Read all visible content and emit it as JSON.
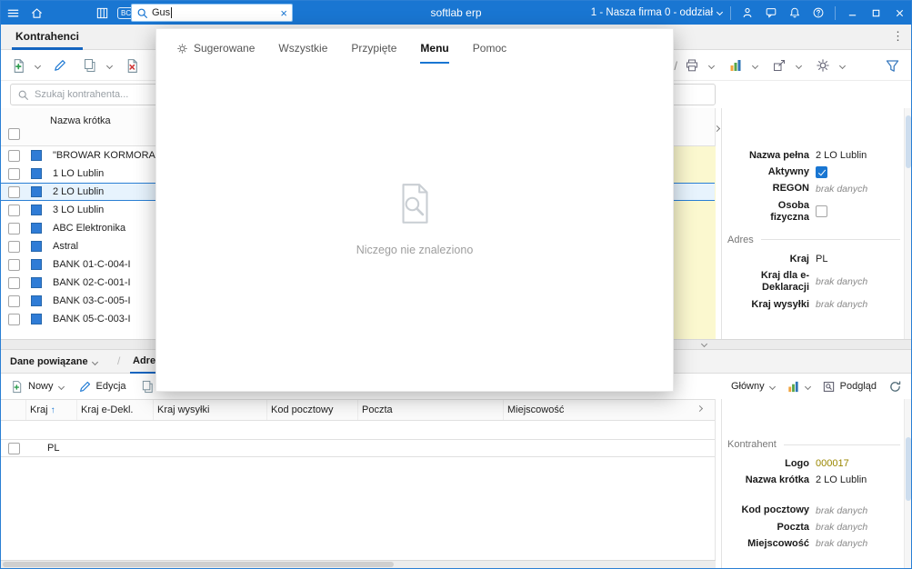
{
  "glyphs": {
    "more_vertical": "⋮",
    "close_x": "×",
    "slash": "/",
    "sort_asc": "↑"
  },
  "topbar": {
    "app_title": "softlab erp",
    "search_value": "Gus",
    "company_selector": "1 - Nasza firma 0 - oddział",
    "bc_badge": "BC"
  },
  "nav": {
    "main_tab": "Kontrahenci"
  },
  "search": {
    "placeholder": "Szukaj kontrahenta..."
  },
  "main_table": {
    "column_header": "Nazwa krótka",
    "rows": [
      {
        "name": "\"BROWAR KORMORAN"
      },
      {
        "name": "1 LO Lublin"
      },
      {
        "name": "2 LO Lublin",
        "selected": true
      },
      {
        "name": "3 LO Lublin"
      },
      {
        "name": "ABC Elektronika"
      },
      {
        "name": "Astral"
      },
      {
        "name": "BANK 01-C-004-I"
      },
      {
        "name": "BANK 02-C-001-I"
      },
      {
        "name": "BANK 03-C-005-I"
      },
      {
        "name": "BANK 05-C-003-I"
      }
    ]
  },
  "details": {
    "nazwa_pelna": {
      "label": "Nazwa pełna",
      "value": "2 LO Lublin"
    },
    "aktywny": {
      "label": "Aktywny",
      "checked": true
    },
    "regon": {
      "label": "REGON",
      "value": "brak danych"
    },
    "osoba_fizyczna": {
      "label": "Osoba fizyczna",
      "checked": false
    },
    "section_adres": "Adres",
    "kraj": {
      "label": "Kraj",
      "value": "PL"
    },
    "kraj_edekl": {
      "label": "Kraj dla e-Deklaracji",
      "value": "brak danych"
    },
    "kraj_wysylki": {
      "label": "Kraj wysyłki",
      "value": "brak danych"
    }
  },
  "search_overlay": {
    "tabs": [
      {
        "label": "Sugerowane"
      },
      {
        "label": "Wszystkie"
      },
      {
        "label": "Przypięte"
      },
      {
        "label": "Menu",
        "active": true
      },
      {
        "label": "Pomoc"
      }
    ],
    "empty_message": "Niczego nie znaleziono"
  },
  "related": {
    "title": "Dane powiązane",
    "active_tab": "Adres",
    "toolbar": {
      "new": "Nowy",
      "edit": "Edycja",
      "view": "Główny",
      "preview": "Podgląd"
    },
    "table": {
      "headers": [
        "Kraj",
        "Kraj e-Dekl.",
        "Kraj wysyłki",
        "Kod pocztowy",
        "Poczta",
        "Miejscowość"
      ],
      "rows": [
        {
          "kraj": "PL"
        }
      ]
    }
  },
  "bottom_panel": {
    "section": "Kontrahent",
    "logo": {
      "label": "Logo",
      "value": "000017"
    },
    "nazwa_krotka": {
      "label": "Nazwa krótka",
      "value": "2 LO Lublin"
    },
    "kod_pocztowy": {
      "label": "Kod pocztowy",
      "value": "brak danych"
    },
    "poczta": {
      "label": "Poczta",
      "value": "brak danych"
    },
    "miejscowosc": {
      "label": "Miejscowość",
      "value": "brak danych"
    }
  },
  "colors": {
    "accent": "#1976d2",
    "selection_bg": "#e7f3fd",
    "editable_column_bg": "#fbf8cf",
    "logo_value": "#9a8700"
  }
}
